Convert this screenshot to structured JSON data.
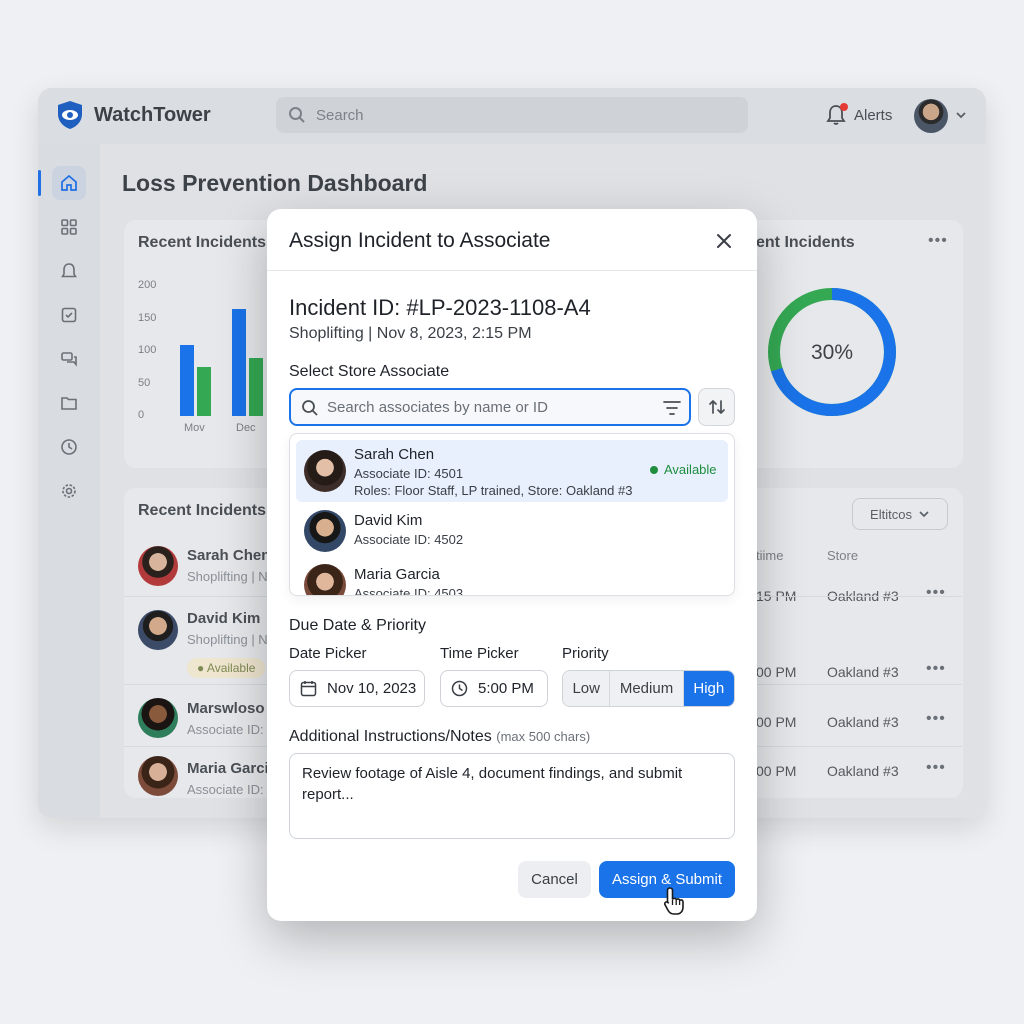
{
  "app": {
    "name": "WatchTower",
    "search_placeholder": "Search",
    "alerts_label": "Alerts",
    "dashboard_title": "Loss Prevention Dashboard"
  },
  "chart_card": {
    "title": "Recent Incidents",
    "chart_data": {
      "type": "bar",
      "categories": [
        "Mov",
        "Dec"
      ],
      "yticks": [
        "200",
        "150",
        "100",
        "50",
        "0"
      ],
      "ylim": [
        0,
        200
      ],
      "series": [
        {
          "color": "#1a73e8",
          "values": [
            110,
            165
          ]
        },
        {
          "color": "#34a853",
          "values": [
            75,
            90
          ]
        }
      ]
    }
  },
  "donut_card": {
    "title": "ent Incidents",
    "percent_label": "30%",
    "percent_value": 30
  },
  "table_card": {
    "title": "Recent Incidents",
    "filter_label": "Eltitcos",
    "headers": {
      "time": "tiime",
      "store": "Store"
    },
    "rows": [
      {
        "name": "Sarah Chen",
        "sub": "Shoplifting | N",
        "time": "15 PM",
        "store": "Oakland #3"
      },
      {
        "name": "David Kim",
        "sub": "Shoplifting | N",
        "badge": "Available",
        "time": "00 PM",
        "store": "Oakland #3"
      },
      {
        "name": "Marswloso",
        "sub": "Associate ID:",
        "time": "00 PM",
        "store": "Oakland #3"
      },
      {
        "name": "Maria Garcia",
        "sub": "Associate ID:",
        "time": "00 PM",
        "store": "Oakland #3"
      }
    ]
  },
  "modal": {
    "title": "Assign Incident to Associate",
    "incident_id": "Incident ID: #LP-2023-1108-A4",
    "incident_sub": "Shoplifting | Nov 8, 2023, 2:15 PM",
    "select_label": "Select Store Associate",
    "search_placeholder": "Search associates by name or ID",
    "associates": [
      {
        "name": "Sarah Chen",
        "id": "Associate ID: 4501",
        "roles": "Roles: Floor Staff, LP trained, Store: Oakland #3",
        "status": "Available"
      },
      {
        "name": "David Kim",
        "id": "Associate ID: 4502"
      },
      {
        "name": "Maria Garcia",
        "id": "Associate ID: 4503"
      }
    ],
    "due_label": "Due Date & Priority",
    "date_label": "Date Picker",
    "date_value": "Nov 10, 2023",
    "time_label": "Time Picker",
    "time_value": "5:00 PM",
    "priority_label": "Priority",
    "priority_options": [
      "Low",
      "Medium",
      "High"
    ],
    "priority_selected": "High",
    "notes_label": "Additional Instructions/Notes",
    "notes_hint": "(max 500 chars)",
    "notes_value": "Review footage of Aisle 4, document findings, and submit report...",
    "cancel_label": "Cancel",
    "submit_label": "Assign & Submit"
  },
  "colors": {
    "accent": "#1a73e8",
    "success": "#1e8e3e",
    "donut_green": "#34a853"
  }
}
